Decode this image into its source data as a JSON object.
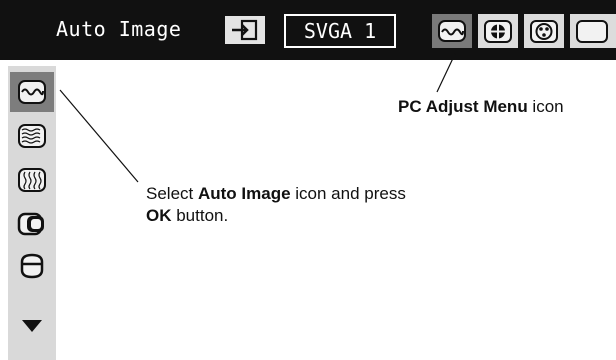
{
  "menubar": {
    "title": "Auto Image",
    "source_label": "SVGA 1",
    "icons": [
      "input-icon",
      "pc-adjust-icon",
      "image-select-icon",
      "image-adjust-icon",
      "screen-icon"
    ]
  },
  "sidebar": {
    "icons": [
      "auto-image-icon",
      "fine-sync-icon",
      "total-dots-icon",
      "position-icon",
      "height-icon",
      "scroll-down-icon"
    ]
  },
  "callouts": {
    "pc_adjust": {
      "bold": "PC Adjust Menu",
      "rest": " icon"
    },
    "auto_image": {
      "line1_pre": "Select ",
      "line1_bold": "Auto Image",
      "line1_post": " icon and press",
      "line2_bold": "OK",
      "line2_post": " button."
    }
  },
  "colors": {
    "bar": "#111111",
    "selected": "#7a7a7a",
    "icon_bg": "#dcdcdc",
    "sidebar_bg": "#d9d9d9"
  }
}
